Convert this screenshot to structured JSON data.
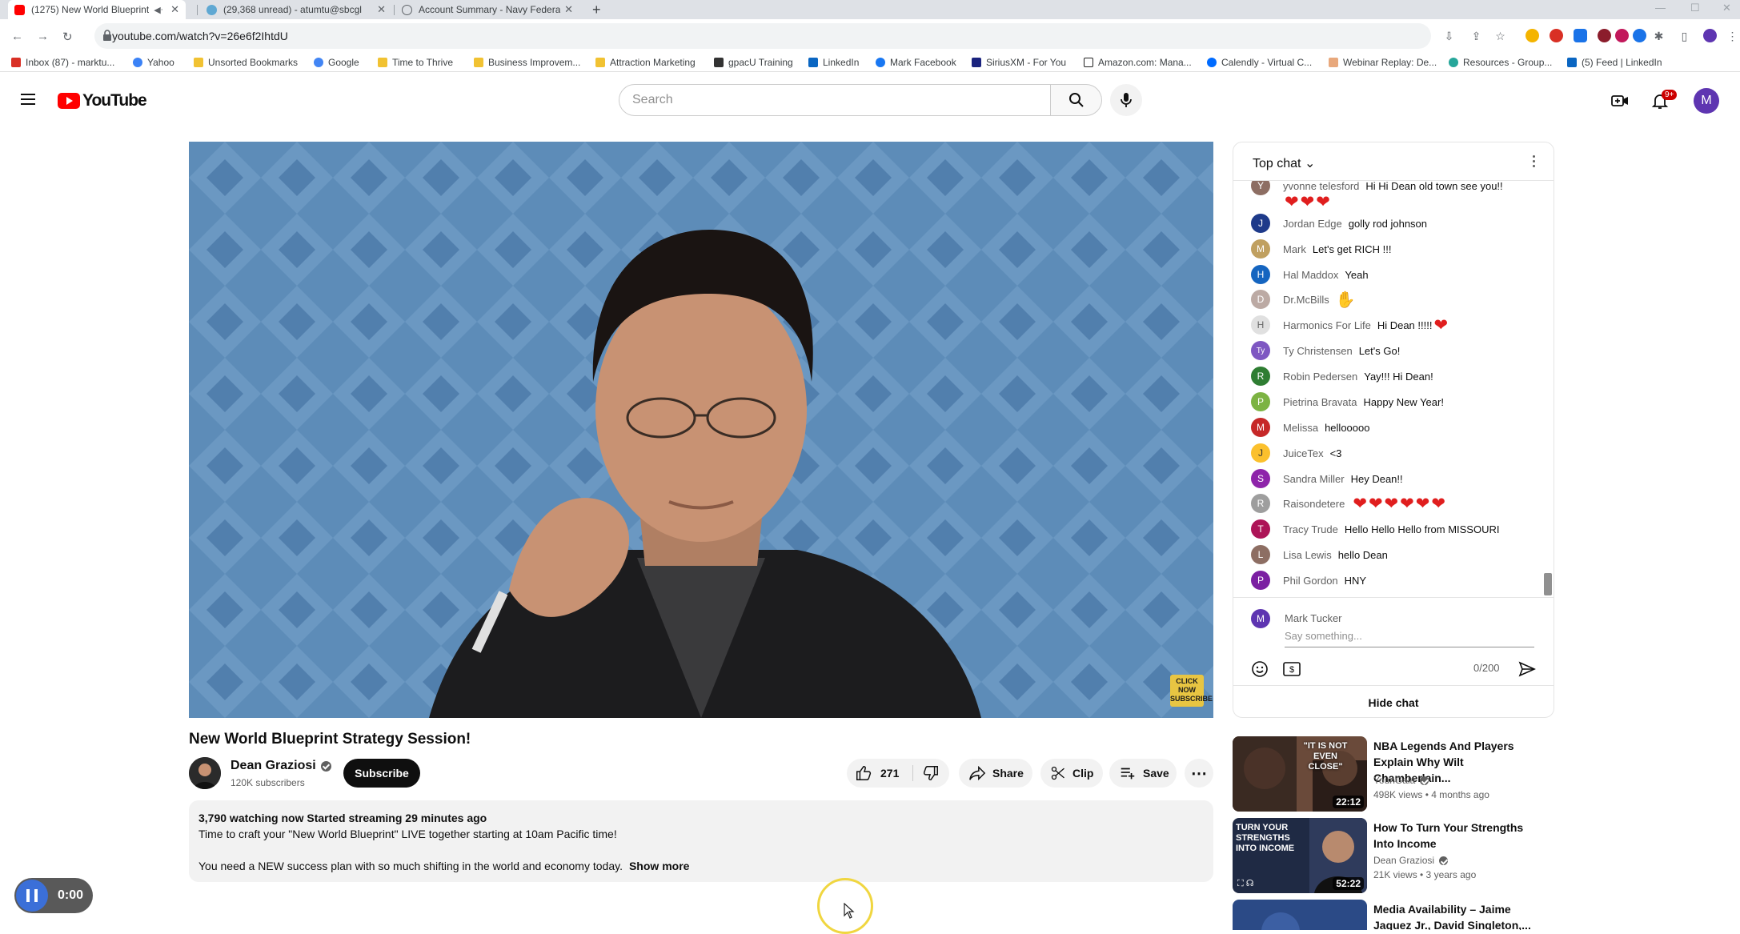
{
  "browser": {
    "tabs": [
      {
        "title": "(1275) New World Blueprint"
      },
      {
        "title": "(29,368 unread) - atumtu@sbcgl"
      },
      {
        "title": "Account Summary - Navy Federa"
      }
    ],
    "url": "youtube.com/watch?v=26e6f2IhtdU",
    "bookmarks": [
      "Inbox (87) - marktu...",
      "Yahoo",
      "Unsorted Bookmarks",
      "Google",
      "Time to Thrive",
      "Business Improvem...",
      "Attraction Marketing",
      "gpacU Training",
      "LinkedIn",
      "Mark Facebook",
      "SiriusXM - For You",
      "Amazon.com: Mana...",
      "Calendly - Virtual C...",
      "Webinar Replay: De...",
      "Resources - Group...",
      "(5) Feed | LinkedIn"
    ]
  },
  "youtube": {
    "logo": "YouTube",
    "search_placeholder": "Search",
    "notif_count": "9+",
    "avatar_letter": "M"
  },
  "player": {
    "overlay_badge": "CLICK NOW SUBSCRIBE",
    "time": "0:00"
  },
  "video": {
    "title": "New World Blueprint Strategy Session!",
    "channel": "Dean Graziosi",
    "subscribers": "120K subscribers",
    "subscribe_label": "Subscribe",
    "likes": "271",
    "share_label": "Share",
    "clip_label": "Clip",
    "save_label": "Save",
    "stats": "3,790 watching now  Started streaming 29 minutes ago",
    "desc_line1": "Time to craft your \"New World Blueprint\" LIVE together starting at 10am Pacific time!",
    "desc_line2": "You need a NEW success plan with so much shifting in the world and economy today.",
    "show_more": "Show more"
  },
  "chat": {
    "header": "Top chat",
    "messages": [
      {
        "author": "yvonne telesford",
        "text": "Hi Hi Dean old town see you!!",
        "initial": "Y",
        "color": "#8d6e63"
      },
      {
        "author": "Jordan Edge",
        "text": "golly rod johnson",
        "initial": "J",
        "color": "#1e3a8a"
      },
      {
        "author": "Mark",
        "text": "Let's get RICH !!!",
        "initial": "M",
        "color": "#c0a060"
      },
      {
        "author": "Hal Maddox",
        "text": "Yeah",
        "initial": "H",
        "color": "#1565c0"
      },
      {
        "author": "Dr.McBills",
        "text": "",
        "initial": "D",
        "color": "#bcaaa4"
      },
      {
        "author": "Harmonics For Life",
        "text": "Hi Dean !!!!!",
        "initial": "H",
        "color": "#e0e0e0"
      },
      {
        "author": "Ty Christensen",
        "text": "Let's Go!",
        "initial": "Ty",
        "color": "#7e57c2"
      },
      {
        "author": "Robin Pedersen",
        "text": "Yay!!! Hi Dean!",
        "initial": "R",
        "color": "#2e7d32"
      },
      {
        "author": "Pietrina Bravata",
        "text": "Happy New Year!",
        "initial": "P",
        "color": "#7cb342"
      },
      {
        "author": "Melissa",
        "text": "hellooooo",
        "initial": "M",
        "color": "#c62828"
      },
      {
        "author": "JuiceTex",
        "text": "<3",
        "initial": "J",
        "color": "#fbc02d"
      },
      {
        "author": "Sandra Miller",
        "text": "Hey Dean!!",
        "initial": "S",
        "color": "#8e24aa"
      },
      {
        "author": "Raisondetere",
        "text": "",
        "initial": "R",
        "color": "#9e9e9e"
      },
      {
        "author": "Tracy Trude",
        "text": "Hello Hello Hello from MISSOURI",
        "initial": "T",
        "color": "#ad1457"
      },
      {
        "author": "Lisa Lewis",
        "text": "hello Dean",
        "initial": "L",
        "color": "#8d6e63"
      },
      {
        "author": "Phil Gordon",
        "text": "HNY",
        "initial": "P",
        "color": "#7b1fa2"
      }
    ],
    "user_name": "Mark Tucker",
    "input_placeholder": "Say something...",
    "char_count": "0/200",
    "hide_label": "Hide chat"
  },
  "recommendations": [
    {
      "title": "NBA Legends And Players Explain Why Wilt Chamberlain...",
      "channel": "YounGala",
      "meta": "498K views • 4 months ago",
      "duration": "22:12",
      "thumb_text": "\"IT IS NOT EVEN CLOSE\""
    },
    {
      "title": "How To Turn Your Strengths Into Income",
      "channel": "Dean Graziosi",
      "meta": "21K views • 3 years ago",
      "duration": "52:22",
      "thumb_text": "TURN YOUR STRENGTHS INTO INCOME"
    },
    {
      "title": "Media Availability – Jaime Jaquez Jr., David Singleton,...",
      "channel": "",
      "meta": "",
      "duration": "",
      "thumb_text": ""
    }
  ]
}
